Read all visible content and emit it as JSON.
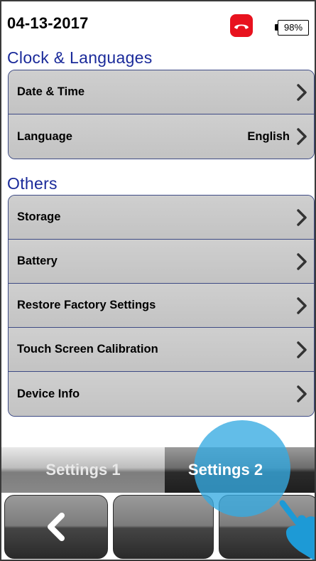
{
  "status": {
    "date": "04-13-2017",
    "call_icon": "hang-up-phone-icon",
    "battery": "98%"
  },
  "clock_section": {
    "title": "Clock & Languages",
    "items": [
      {
        "label": "Date & Time",
        "value": ""
      },
      {
        "label": "Language",
        "value": "English"
      }
    ]
  },
  "others_section": {
    "title": "Others",
    "items": [
      {
        "label": "Storage"
      },
      {
        "label": "Battery"
      },
      {
        "label": "Restore Factory Settings"
      },
      {
        "label": "Touch Screen Calibration"
      },
      {
        "label": "Device Info"
      }
    ]
  },
  "tabs": [
    {
      "label": "Settings 1",
      "active": false
    },
    {
      "label": "Settings 2",
      "active": true
    }
  ],
  "bottom_buttons": {
    "back_icon": "chevron-left-icon"
  },
  "colors": {
    "section_title": "#1a2a9a",
    "row_bg": "#c7c7c7",
    "group_border": "#3d4a84",
    "call_red": "#e8121e",
    "touch_hint": "#36aae1"
  }
}
